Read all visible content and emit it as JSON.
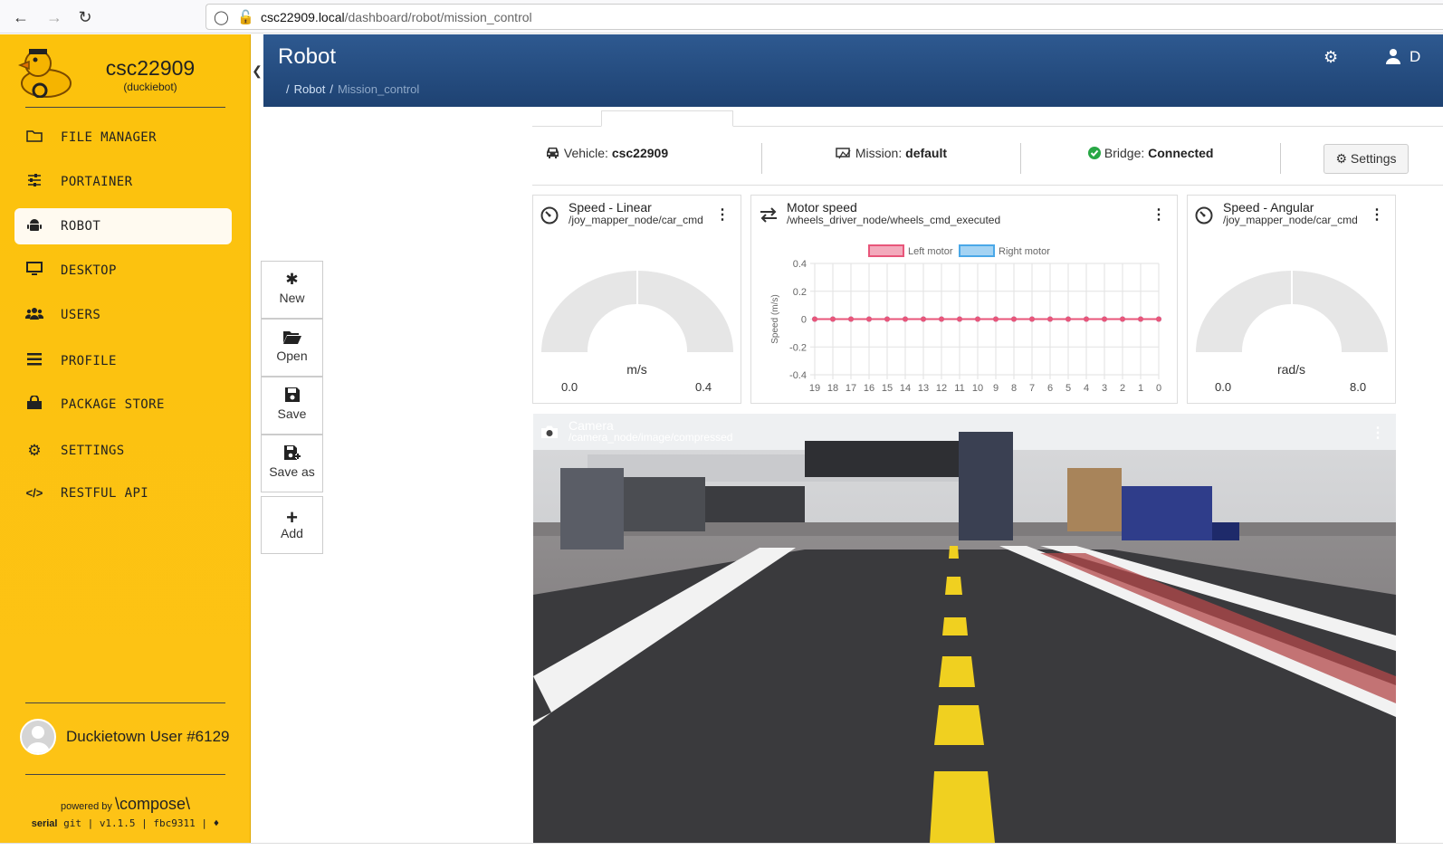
{
  "browser": {
    "url_host": "csc22909.local",
    "url_path": "/dashboard/robot/mission_control",
    "back_icon": "arrow-left-icon",
    "forward_icon": "arrow-right-icon",
    "reload_icon": "reload-icon"
  },
  "sidebar": {
    "host_name": "csc22909",
    "host_type": "(duckiebot)",
    "items": [
      {
        "label": "FILE MANAGER",
        "icon": "folder-icon"
      },
      {
        "label": "PORTAINER",
        "icon": "sliders-icon"
      },
      {
        "label": "ROBOT",
        "icon": "android-icon"
      },
      {
        "label": "DESKTOP",
        "icon": "monitor-icon"
      },
      {
        "label": "USERS",
        "icon": "users-icon"
      },
      {
        "label": "PROFILE",
        "icon": "list-icon"
      },
      {
        "label": "PACKAGE STORE",
        "icon": "shopping-bag-icon"
      },
      {
        "label": "SETTINGS",
        "icon": "gear-icon"
      },
      {
        "label": "RESTFUL API",
        "icon": "code-icon"
      }
    ],
    "active_item": "ROBOT",
    "user_name": "Duckietown User #6129",
    "powered_by": "powered by",
    "brand": "\\compose\\",
    "version_kind": "serial",
    "version_text": "git | v1.1.5 | fbc9311 |",
    "accent_color": "#fcc20c"
  },
  "header": {
    "title": "Robot",
    "breadcrumb": [
      "Robot",
      "Mission_control"
    ]
  },
  "toolbar": {
    "new_label": "New",
    "open_label": "Open",
    "save_label": "Save",
    "save_as_label": "Save as",
    "add_label": "Add"
  },
  "status": {
    "vehicle_label": "Vehicle:",
    "vehicle_value": "csc22909",
    "mission_label": "Mission:",
    "mission_value": "default",
    "bridge_label": "Bridge:",
    "bridge_value": "Connected",
    "settings_label": "Settings"
  },
  "widgets": {
    "speed_linear": {
      "title": "Speed - Linear",
      "topic": "/joy_mapper_node/car_cmd",
      "unit": "m/s",
      "min": "0.0",
      "max": "0.4",
      "value": 0
    },
    "motor_speed": {
      "title": "Motor speed",
      "topic": "/wheels_driver_node/wheels_cmd_executed"
    },
    "speed_angular": {
      "title": "Speed - Angular",
      "topic": "/joy_mapper_node/car_cmd",
      "unit": "rad/s",
      "min": "0.0",
      "max": "8.0",
      "value": 0
    },
    "camera": {
      "title": "Camera",
      "topic": "/camera_node/image/compressed"
    }
  },
  "chart_data": {
    "type": "line",
    "title": "",
    "ylabel": "Speed (m/s)",
    "xlabel": "",
    "x": [
      19,
      18,
      17,
      16,
      15,
      14,
      13,
      12,
      11,
      10,
      9,
      8,
      7,
      6,
      5,
      4,
      3,
      2,
      1,
      0
    ],
    "ylim": [
      -0.4,
      0.4
    ],
    "yticks": [
      "0.4",
      "0.2",
      "0",
      "-0.2",
      "-0.4"
    ],
    "grid": true,
    "legend_position": "top",
    "series": [
      {
        "name": "Left motor",
        "color": "#e8567a",
        "values": [
          0,
          0,
          0,
          0,
          0,
          0,
          0,
          0,
          0,
          0,
          0,
          0,
          0,
          0,
          0,
          0,
          0,
          0,
          0,
          0
        ]
      },
      {
        "name": "Right motor",
        "color": "#4aa8e8",
        "values": [
          0,
          0,
          0,
          0,
          0,
          0,
          0,
          0,
          0,
          0,
          0,
          0,
          0,
          0,
          0,
          0,
          0,
          0,
          0,
          0
        ]
      }
    ]
  }
}
